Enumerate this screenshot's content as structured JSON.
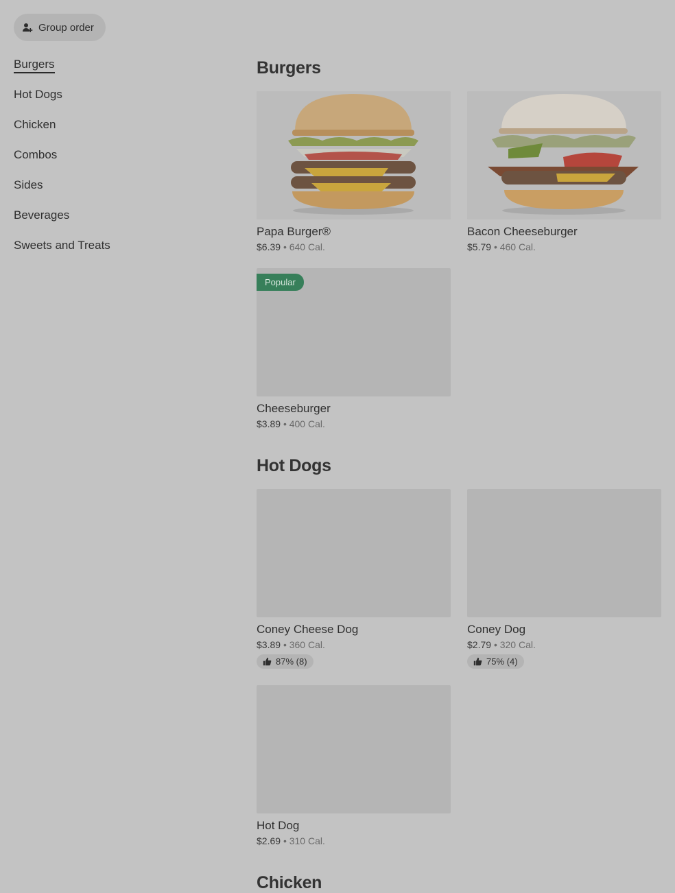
{
  "header": {
    "group_order_label": "Group order"
  },
  "sidebar": {
    "items": [
      {
        "label": "Burgers"
      },
      {
        "label": "Hot Dogs"
      },
      {
        "label": "Chicken"
      },
      {
        "label": "Combos"
      },
      {
        "label": "Sides"
      },
      {
        "label": "Beverages"
      },
      {
        "label": "Sweets and Treats"
      }
    ]
  },
  "sections": [
    {
      "title": "Burgers",
      "items": [
        {
          "name": "Papa Burger®",
          "price": "$6.39",
          "calories": "640 Cal."
        },
        {
          "name": "Bacon Cheeseburger",
          "price": "$5.79",
          "calories": "460 Cal."
        },
        {
          "name": "Cheeseburger",
          "price": "$3.89",
          "calories": "400 Cal.",
          "badge": "Popular"
        }
      ]
    },
    {
      "title": "Hot Dogs",
      "items": [
        {
          "name": "Coney Cheese Dog",
          "price": "$3.89",
          "calories": "360 Cal.",
          "rating": "87% (8)"
        },
        {
          "name": "Coney Dog",
          "price": "$2.79",
          "calories": "320 Cal.",
          "rating": "75% (4)"
        },
        {
          "name": "Hot Dog",
          "price": "$2.69",
          "calories": "310 Cal."
        }
      ]
    },
    {
      "title": "Chicken"
    }
  ],
  "separator": "•",
  "icons": {
    "group_order": "add-person-icon",
    "rating": "thumbs-up-icon"
  }
}
